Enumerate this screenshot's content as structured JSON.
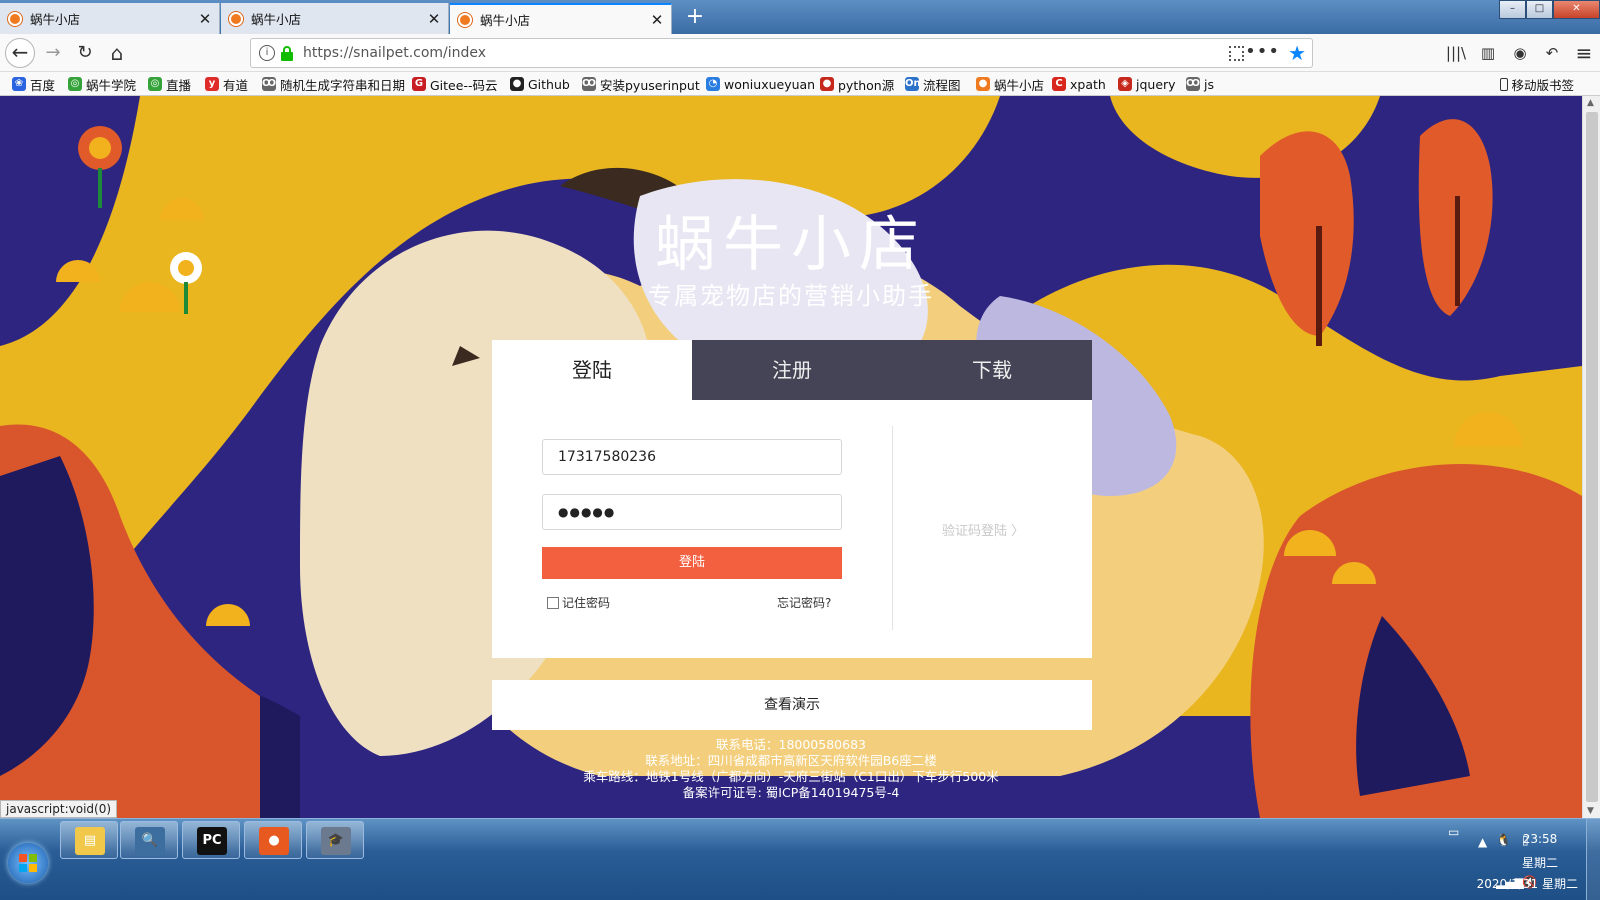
{
  "browser": {
    "tabs": [
      {
        "title": "蜗牛小店",
        "close": "✕"
      },
      {
        "title": "蜗牛小店",
        "close": "✕"
      },
      {
        "title": "蜗牛小店",
        "close": "✕"
      }
    ],
    "new_tab": "+",
    "window_controls": {
      "minimize": "–",
      "maximize": "□",
      "close": "✕"
    },
    "nav": {
      "back": "←",
      "forward": "→",
      "reload": "↻",
      "home": "⌂"
    },
    "url": "https://snailpet.com/index",
    "url_actions": {
      "more": "•••",
      "bookmark_star": "★"
    },
    "toolbar_icons": {
      "library": "|||\\",
      "sidebar": "▥",
      "account": "◉",
      "undo": "↶",
      "menu": "≡"
    },
    "bookmarks": [
      {
        "label": "百度",
        "icon": "paw-icon",
        "color": "#2b63e0",
        "glyph": "❀"
      },
      {
        "label": "蜗牛学院",
        "icon": "snail-icon",
        "color": "#36a33a",
        "glyph": "◎"
      },
      {
        "label": "直播",
        "icon": "snail-icon",
        "color": "#36a33a",
        "glyph": "◎"
      },
      {
        "label": "有道",
        "icon": "youdao-icon",
        "color": "#e02b2b",
        "glyph": "y"
      },
      {
        "label": "随机生成字符串和日期",
        "icon": "tool-icon",
        "color": "#666666",
        "glyph": "Ꝏ"
      },
      {
        "label": "Gitee--码云",
        "icon": "gitee-icon",
        "color": "#c71d23",
        "glyph": "G"
      },
      {
        "label": "Github",
        "icon": "github-icon",
        "color": "#222222",
        "glyph": "●"
      },
      {
        "label": "安装pyuserinput",
        "icon": "tool-icon",
        "color": "#666666",
        "glyph": "Ꝏ"
      },
      {
        "label": "woniuxueyuan",
        "icon": "link-icon",
        "color": "#2a7de1",
        "glyph": "◔"
      },
      {
        "label": "python源",
        "icon": "python-icon",
        "color": "#c6281d",
        "glyph": "●"
      },
      {
        "label": "流程图",
        "icon": "flowchart-icon",
        "color": "#2c73c9",
        "glyph": "On"
      },
      {
        "label": "蜗牛小店",
        "icon": "snailpet-icon",
        "color": "#f07a1f",
        "glyph": "●"
      },
      {
        "label": "xpath",
        "icon": "csdn-icon",
        "color": "#d9261c",
        "glyph": "C"
      },
      {
        "label": "jquery",
        "icon": "jquery-icon",
        "color": "#c6281d",
        "glyph": "◈"
      },
      {
        "label": "js",
        "icon": "tool-icon",
        "color": "#666666",
        "glyph": "Ꝏ"
      }
    ],
    "mobile_bookmarks": "移动版书签",
    "status_link": "javascript:void(0)"
  },
  "page": {
    "brand_title": "蜗牛小店",
    "slogan": "专属宠物店的营销小助手",
    "tabs": [
      {
        "label": "登陆",
        "active": true
      },
      {
        "label": "注册",
        "active": false
      },
      {
        "label": "下载",
        "active": false
      }
    ],
    "login": {
      "phone_value": "17317580236",
      "password_mask": "●●●●●",
      "submit_label": "登陆",
      "remember_label": "记住密码",
      "forgot_label": "忘记密码?",
      "sms_login_label": "验证码登陆 〉"
    },
    "demo_label": "查看演示",
    "footer": [
      "联系电话：18000580683",
      "联系地址：四川省成都市高新区天府软件园B6座二楼",
      "乘车路线：地铁1号线（广都方向）-天府三街站（C1口出）下车步行500米",
      "备案许可证号: 蜀ICP备14019475号-4"
    ],
    "colors": {
      "primary": "#f36040",
      "tab_bar": "#454456",
      "page_bg": "#2e2580",
      "yellow": "#e9b620"
    }
  },
  "taskbar": {
    "apps": [
      {
        "name": "explorer",
        "glyph": "▤",
        "color": "#f2c84b"
      },
      {
        "name": "system-monitor",
        "glyph": "🔍",
        "color": "#3c6e9f"
      },
      {
        "name": "pycharm",
        "glyph": "PC",
        "color": "#111111"
      },
      {
        "name": "firefox",
        "glyph": "●",
        "color": "#e8591f"
      },
      {
        "name": "education",
        "glyph": "🎓",
        "color": "#6b7a8e"
      }
    ],
    "time": "23:58",
    "weekday": "星期二",
    "date": "2020/3/31 星期二"
  }
}
